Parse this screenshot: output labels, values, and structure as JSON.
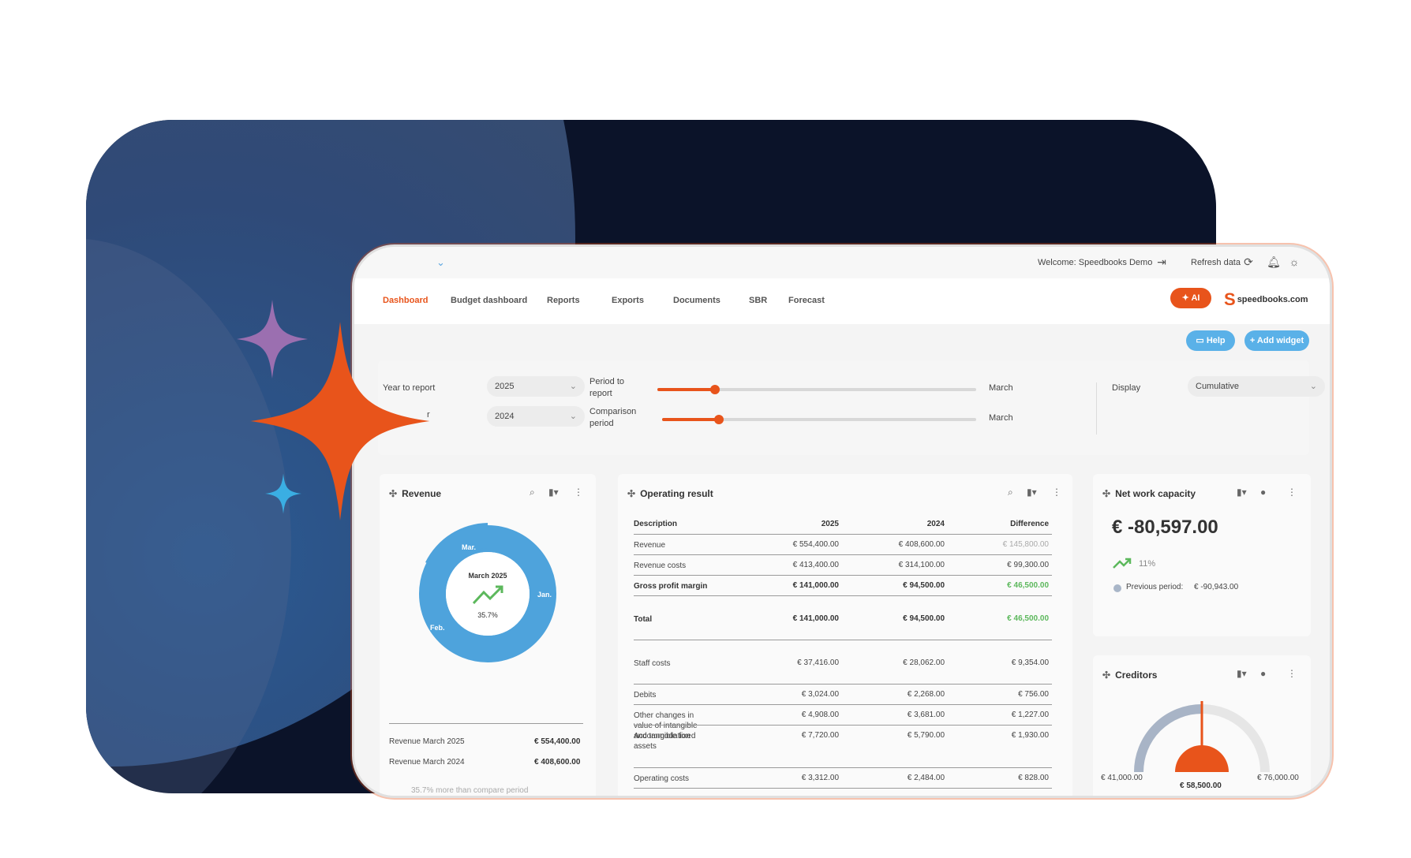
{
  "topbar": {
    "welcome": "Welcome: Speedbooks Demo",
    "refresh": "Refresh data"
  },
  "nav": {
    "items": [
      "Dashboard",
      "Budget dashboard",
      "Reports",
      "Exports",
      "Documents",
      "SBR",
      "Forecast"
    ],
    "ai_label": "AI",
    "logo_text": "speedbooks.com"
  },
  "actions": {
    "help": "Help",
    "add_widget": "+ Add widget"
  },
  "filters": {
    "year_label": "Year to report",
    "year_value": "2025",
    "compare_label": "r",
    "compare_value": "2024",
    "period_label_1": "Period to",
    "period_label_2": "report",
    "period_value": "March",
    "period_fraction": 0.18,
    "comparison_label_1": "Comparison",
    "comparison_label_2": "period",
    "comparison_value": "March",
    "comparison_fraction": 0.18,
    "display_label": "Display",
    "display_value": "Cumulative"
  },
  "revenue": {
    "title": "Revenue",
    "center_title": "March 2025",
    "center_value": "35.7%",
    "slice_labels": [
      "Jan.",
      "Feb.",
      "Mar."
    ],
    "rows": [
      {
        "label": "Revenue March 2025",
        "value": "€ 554,400.00"
      },
      {
        "label": "Revenue March 2024",
        "value": "€ 408,600.00"
      }
    ],
    "footnote": "35.7% more than compare period"
  },
  "operating": {
    "title": "Operating result",
    "headers": [
      "Description",
      "2025",
      "2024",
      "Difference"
    ],
    "rows": [
      {
        "d": "Revenue",
        "a": "€ 554,400.00",
        "b": "€ 408,600.00",
        "c": "€ 145,800.00",
        "bold": false,
        "style": "muted"
      },
      {
        "d": "Revenue costs",
        "a": "€ 413,400.00",
        "b": "€ 314,100.00",
        "c": "€ 99,300.00",
        "bold": false,
        "style": ""
      },
      {
        "d": "Gross profit margin",
        "a": "€ 141,000.00",
        "b": "€ 94,500.00",
        "c": "€ 46,500.00",
        "bold": true,
        "style": "green"
      },
      {
        "d": "Total",
        "a": "€ 141,000.00",
        "b": "€ 94,500.00",
        "c": "€ 46,500.00",
        "bold": true,
        "style": "green"
      },
      {
        "d": "Staff costs",
        "a": "€ 37,416.00",
        "b": "€ 28,062.00",
        "c": "€ 9,354.00",
        "bold": false,
        "style": ""
      },
      {
        "d": "Debits",
        "a": "€ 3,024.00",
        "b": "€ 2,268.00",
        "c": "€ 756.00",
        "bold": false,
        "style": ""
      },
      {
        "d": "Other changes in value of intangible and tangible fixed assets",
        "a": "€ 4,908.00",
        "b": "€ 3,681.00",
        "c": "€ 1,227.00",
        "bold": false,
        "style": ""
      },
      {
        "d": "Accommodation",
        "a": "€ 7,720.00",
        "b": "€ 5,790.00",
        "c": "€ 1,930.00",
        "bold": false,
        "style": ""
      },
      {
        "d": "Operating costs",
        "a": "€ 3,312.00",
        "b": "€ 2,484.00",
        "c": "€ 828.00",
        "bold": false,
        "style": ""
      }
    ]
  },
  "networking": {
    "title": "Net work capacity",
    "value": "€ -80,597.00",
    "change": "11%",
    "previous_label": "Previous period:",
    "previous_value": "€ -90,943.00"
  },
  "creditors": {
    "title": "Creditors",
    "min": "€ 41,000.00",
    "max": "€ 76,000.00",
    "current": "€ 58,500.00",
    "gauge_fraction": 0.5
  },
  "colors": {
    "accent": "#e8541b",
    "blue": "#5ab1e8",
    "donut": "#4ea3dc",
    "green": "#5cb85c",
    "star_purple": "#9b6fb0",
    "star_cyan": "#3aaee3",
    "background_dark": "#0b1329"
  }
}
